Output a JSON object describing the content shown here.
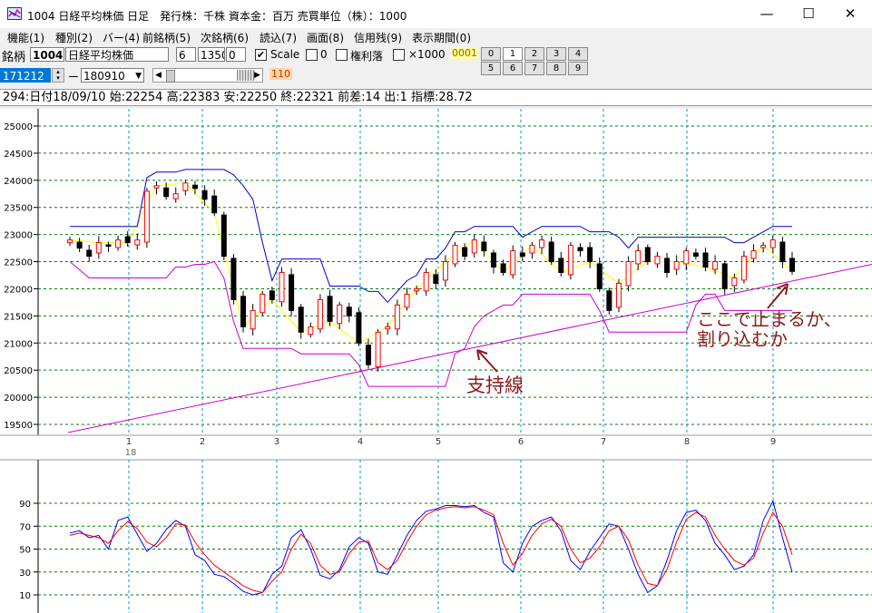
{
  "window": {
    "title": "1004 日経平均株価 日足　発行株：千株 資本金：百万 売買単位（株）：1000",
    "minimize": "—",
    "maximize": "☐",
    "close": "✕"
  },
  "menu": [
    "機能(1)",
    "種別(2)",
    "バー(4)",
    "前銘柄(5)",
    "次銘柄(6)",
    "読込(7)",
    "画面(8)",
    "信用残(9)",
    "表示期間(0)"
  ],
  "toolbar": {
    "meigara_label": "銘柄",
    "code": "1004",
    "name": "日経平均株価",
    "field_a": "6",
    "field_b": "1350",
    "field_c": "0",
    "scale_label": "Scale",
    "scale_checked": "✔",
    "zero_label": "0",
    "kenri_label": "権利落",
    "x1000_label": "×1000",
    "badge": "0001",
    "date_from": "171212",
    "dash": "ー",
    "date_to": "180910",
    "value_110": "110",
    "num_buttons": [
      "0",
      "1",
      "2",
      "3",
      "4",
      "5",
      "6",
      "7",
      "8",
      "9"
    ]
  },
  "info": "294:日付18/09/10 始:22254 高:22383 安:22250 終:22321 前差:14 出:1 指標:28.72",
  "colors": {
    "up": "#ff0000",
    "down": "#000000",
    "ma": "#0000cc",
    "channel": "#cc00cc",
    "zigzag": "#ffff00",
    "annotation": "#8b1a1a"
  },
  "chart_data": [
    {
      "type": "candlestick",
      "ylim": [
        19500,
        25000
      ],
      "y_ticks": [
        "25000",
        "24500",
        "24000",
        "23500",
        "23000",
        "22500",
        "22000",
        "21500",
        "21000",
        "20500",
        "20000",
        "19500"
      ],
      "x_ticks": [
        "1",
        "2",
        "3",
        "4",
        "5",
        "6",
        "7",
        "8",
        "9"
      ],
      "x_sub": "18",
      "closes": [
        22900,
        22750,
        22600,
        22850,
        22800,
        22900,
        22850,
        22900,
        23800,
        23900,
        23700,
        23750,
        23950,
        23850,
        23650,
        23400,
        22600,
        21800,
        21300,
        21600,
        21900,
        21800,
        22300,
        21600,
        21200,
        21300,
        21800,
        21400,
        21700,
        21500,
        21000,
        20600,
        21200,
        21300,
        21700,
        21900,
        22000,
        22300,
        22100,
        22500,
        22800,
        22600,
        22900,
        22700,
        22400,
        22300,
        22700,
        22600,
        22800,
        22900,
        22500,
        22300,
        22800,
        22700,
        22500,
        22000,
        21600,
        22100,
        22500,
        22700,
        22500,
        22600,
        22300,
        22500,
        22700,
        22600,
        22400,
        22500,
        22000,
        22200,
        22600,
        22700,
        22800,
        22900,
        22500,
        22321
      ],
      "support_line": {
        "from": 19350,
        "to": 22450
      },
      "annotations": [
        "支持線",
        "ここで止まるか、",
        "割り込むか"
      ]
    },
    {
      "type": "line",
      "ylim": [
        0,
        100
      ],
      "y_ticks": [
        "90",
        "70",
        "50",
        "30",
        "10"
      ],
      "series": [
        {
          "values": [
            64,
            66,
            60,
            62,
            50,
            75,
            78,
            63,
            48,
            55,
            67,
            75,
            70,
            45,
            40,
            28,
            26,
            20,
            13,
            10,
            12,
            28,
            35,
            60,
            67,
            50,
            27,
            24,
            32,
            52,
            60,
            55,
            30,
            28,
            45,
            62,
            75,
            83,
            85,
            88,
            88,
            87,
            88,
            82,
            78,
            38,
            30,
            55,
            70,
            75,
            78,
            66,
            40,
            32,
            48,
            60,
            72,
            70,
            50,
            28,
            12,
            18,
            40,
            66,
            82,
            84,
            75,
            55,
            45,
            32,
            35,
            45,
            75,
            92,
            60,
            30
          ]
        },
        {
          "values": [
            62,
            64,
            62,
            60,
            55,
            66,
            74,
            68,
            56,
            52,
            60,
            72,
            71,
            56,
            45,
            36,
            30,
            24,
            18,
            14,
            12,
            22,
            30,
            50,
            63,
            55,
            36,
            28,
            30,
            46,
            56,
            57,
            38,
            32,
            40,
            56,
            70,
            80,
            84,
            86,
            87,
            86,
            87,
            84,
            80,
            55,
            36,
            46,
            62,
            72,
            76,
            70,
            50,
            38,
            42,
            52,
            66,
            70,
            58,
            36,
            20,
            18,
            32,
            56,
            76,
            82,
            78,
            62,
            50,
            40,
            36,
            42,
            64,
            82,
            70,
            45
          ]
        }
      ]
    }
  ]
}
